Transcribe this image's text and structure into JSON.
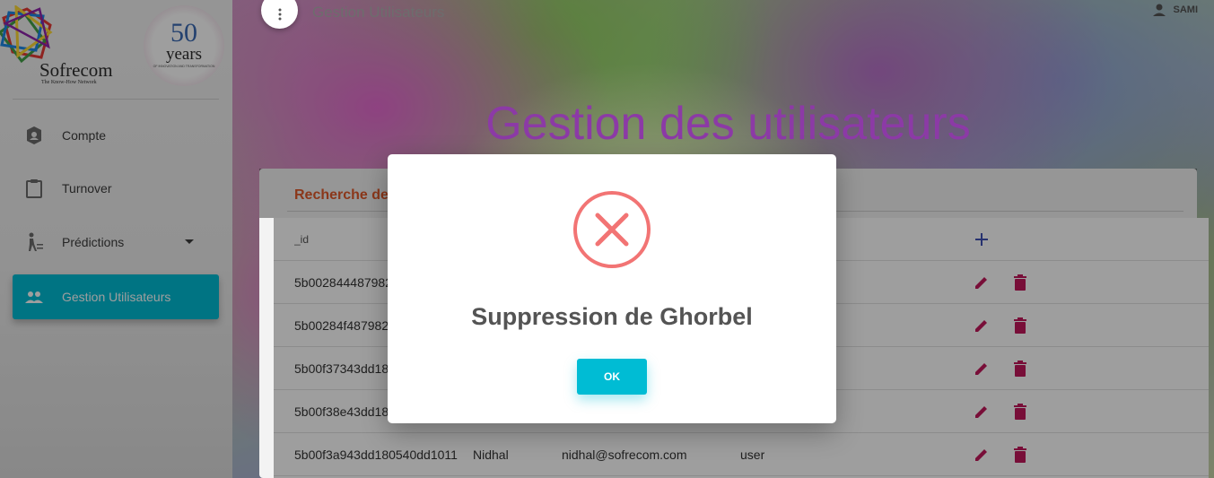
{
  "app": {
    "brand_name": "Sofrecom",
    "brand_tagline": "The Know-How Network",
    "anniversary_number": "50",
    "anniversary_word": "years",
    "anniversary_sub": "OF INNOVATION AND TRANSFORMATION"
  },
  "sidebar": {
    "items": [
      {
        "label": "Compte",
        "icon": "account-icon"
      },
      {
        "label": "Turnover",
        "icon": "clipboard-icon"
      },
      {
        "label": "Prédictions",
        "icon": "predictions-icon"
      },
      {
        "label": "Gestion Utilisateurs",
        "icon": "people-icon",
        "active": true
      }
    ]
  },
  "header": {
    "title": "Gestion Utilisateurs",
    "user": "SAMI"
  },
  "page": {
    "hero_title": "Gestion des utilisateurs",
    "card_header": "Recherche de"
  },
  "table": {
    "id_header": "_id",
    "rows": [
      {
        "id": "5b002844487982",
        "name": "",
        "email": "",
        "role": ""
      },
      {
        "id": "5b00284f487982",
        "name": "",
        "email": "",
        "role": ""
      },
      {
        "id": "5b00f37343dd18",
        "name": "",
        "email": "",
        "role": ""
      },
      {
        "id": "5b00f38e43dd18",
        "name": "",
        "email": "",
        "role": ""
      },
      {
        "id": "5b00f3a943dd180540dd1011",
        "name": "Nidhal",
        "email": "nidhal@sofrecom.com",
        "role": "user"
      }
    ]
  },
  "modal": {
    "title": "Suppression de Ghorbel",
    "ok_label": "OK",
    "icon": "error-x-icon"
  },
  "colors": {
    "accent": "#00bcd4",
    "hero": "#8c3aa6",
    "action": "#c2185b",
    "error": "#f27474",
    "card_header": "#e05a2b"
  }
}
